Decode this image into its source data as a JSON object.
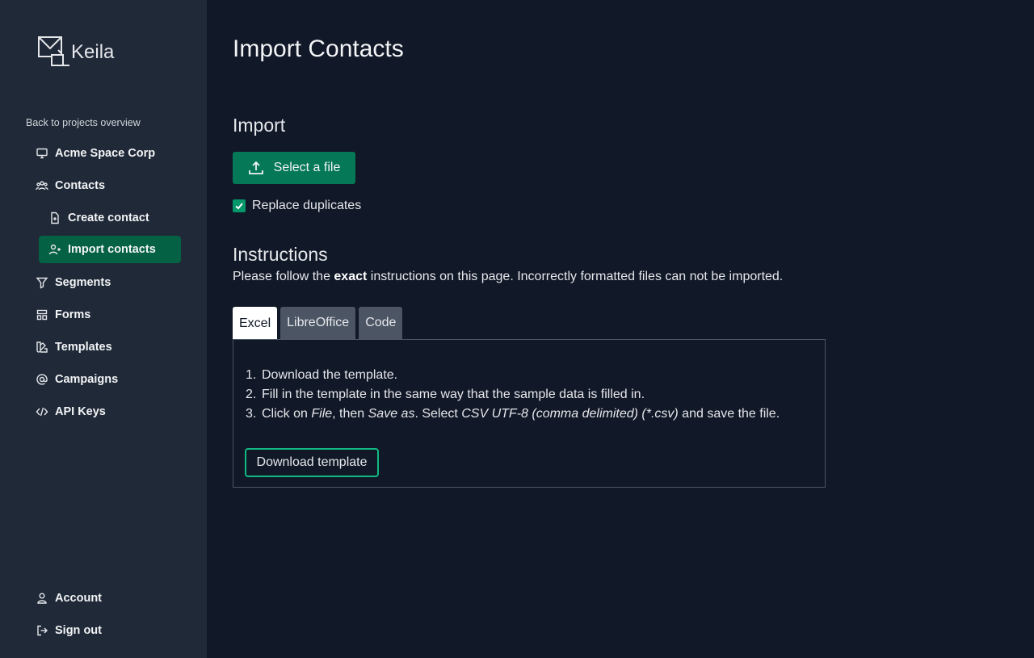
{
  "brand": {
    "name": "Keila"
  },
  "sidebar": {
    "back_link": "Back to projects overview",
    "project": {
      "label": "Acme Space Corp",
      "icon": "monitor-icon"
    },
    "contacts": {
      "label": "Contacts",
      "icon": "users-icon"
    },
    "create_contact": {
      "label": "Create contact",
      "icon": "file-plus-icon"
    },
    "import_contacts": {
      "label": "Import contacts",
      "icon": "user-add-icon"
    },
    "segments": {
      "label": "Segments",
      "icon": "filter-icon"
    },
    "forms": {
      "label": "Forms",
      "icon": "form-icon"
    },
    "templates": {
      "label": "Templates",
      "icon": "color-swatch-icon"
    },
    "campaigns": {
      "label": "Campaigns",
      "icon": "at-icon"
    },
    "api_keys": {
      "label": "API Keys",
      "icon": "code-icon"
    },
    "account": {
      "label": "Account",
      "icon": "user-icon"
    },
    "sign_out": {
      "label": "Sign out",
      "icon": "logout-icon"
    }
  },
  "main": {
    "title": "Import Contacts",
    "import_heading": "Import",
    "select_file_label": "Select a file",
    "replace_duplicates_label": "Replace duplicates",
    "replace_duplicates_checked": true,
    "instructions_heading": "Instructions",
    "instructions_pre": "Please follow the ",
    "instructions_bold": "exact",
    "instructions_post": " instructions on this page. Incorrectly formatted files can not be imported.",
    "tabs": [
      {
        "label": "Excel",
        "active": true
      },
      {
        "label": "LibreOffice",
        "active": false
      },
      {
        "label": "Code",
        "active": false
      }
    ],
    "steps": {
      "s1": "Download the template.",
      "s2": "Fill in the template in the same way that the sample data is filled in.",
      "s3_a": "Click on ",
      "s3_file": "File",
      "s3_b": ", then ",
      "s3_saveas": "Save as",
      "s3_c": ". Select ",
      "s3_format": "CSV UTF-8 (comma delimited) (*.csv)",
      "s3_d": " and save the file."
    },
    "download_label": "Download template"
  },
  "colors": {
    "background": "#111827",
    "sidebar": "#1f2937",
    "accent": "#047857",
    "active_nav": "#056144",
    "outline": "#10b981"
  }
}
